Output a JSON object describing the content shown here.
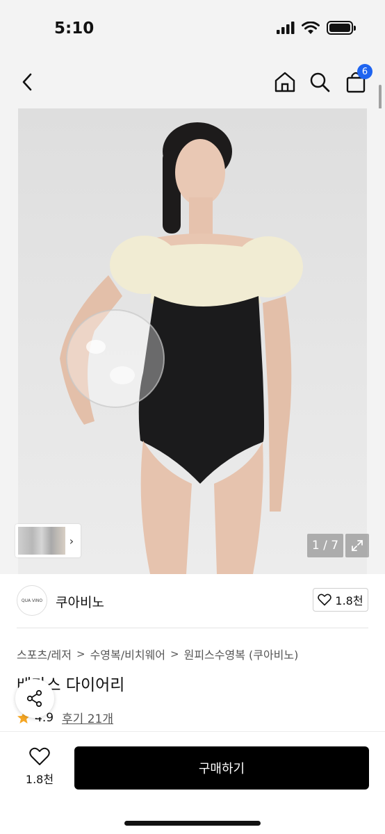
{
  "status_bar": {
    "time": "5:10"
  },
  "nav": {
    "cart_count": "6"
  },
  "gallery": {
    "page_indicator": "1 / 7"
  },
  "seller": {
    "logo_text": "QUA VINO",
    "name": "쿠아비노",
    "likes": "1.8천"
  },
  "breadcrumb": [
    "스포츠/레저",
    "수영복/비치웨어",
    "원피스수영복 (쿠아비노)"
  ],
  "product": {
    "title": "베가스 다이어리",
    "rating": "4.9",
    "reviews": "후기 21개"
  },
  "bottom_bar": {
    "wish_count": "1.8천",
    "buy_label": "구매하기"
  },
  "colors": {
    "accent_badge": "#1e64f0",
    "star": "#f5a623",
    "buy_button": "#000000"
  }
}
